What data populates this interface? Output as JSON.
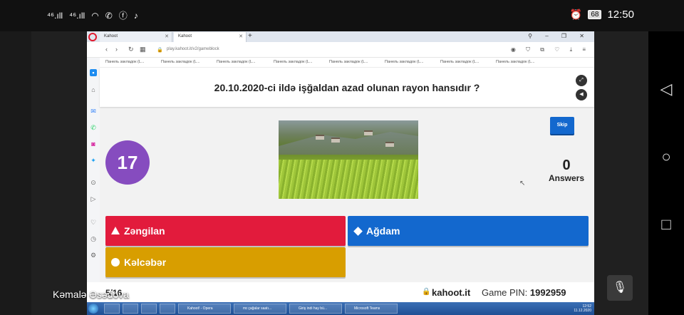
{
  "status_bar": {
    "signal_1": "⁴⁶.ıll",
    "signal_2": "⁴⁶.ıll",
    "time": "12:50",
    "battery": "68"
  },
  "browser": {
    "tabs": [
      "Kahoot",
      "Kahoot"
    ],
    "url": "play.kahoot.it/v2/gameblock",
    "bookmarks": [
      "Панель закладок (L...",
      "Панель закладок (L...",
      "Панель закладок (L...",
      "Панель закладок (L...",
      "Панель закладок (L...",
      "Панель закладок (L...",
      "Панель закладок (L...",
      "Панель закладок (L..."
    ]
  },
  "game": {
    "question": "20.10.2020-ci ildə işğaldan azad olunan rayon hansıdır ?",
    "skip_label": "Skip",
    "timer": "17",
    "answers_count": "0",
    "answers_label": "Answers",
    "answers": [
      {
        "label": "Zəngilan",
        "shape": "triangle",
        "color": "#e21b3c"
      },
      {
        "label": "Ağdam",
        "shape": "diamond",
        "color": "#1368ce"
      },
      {
        "label": "Kəlcəbər",
        "shape": "circle",
        "color": "#d89e00"
      }
    ],
    "question_counter": "5/16",
    "site": "kahoot.it",
    "game_pin_label": "Game PIN:",
    "game_pin": "1992959"
  },
  "taskbar": {
    "items": [
      "",
      "",
      "",
      "",
      "Kahoot! - Opera",
      "mɪ çağalar saatı...",
      "Giriş indi hay bü...",
      "Microsoft Teams"
    ],
    "time": "12:52",
    "date": "11.12.2020"
  },
  "call": {
    "caller_name": "Kəmalə Əsədova"
  }
}
